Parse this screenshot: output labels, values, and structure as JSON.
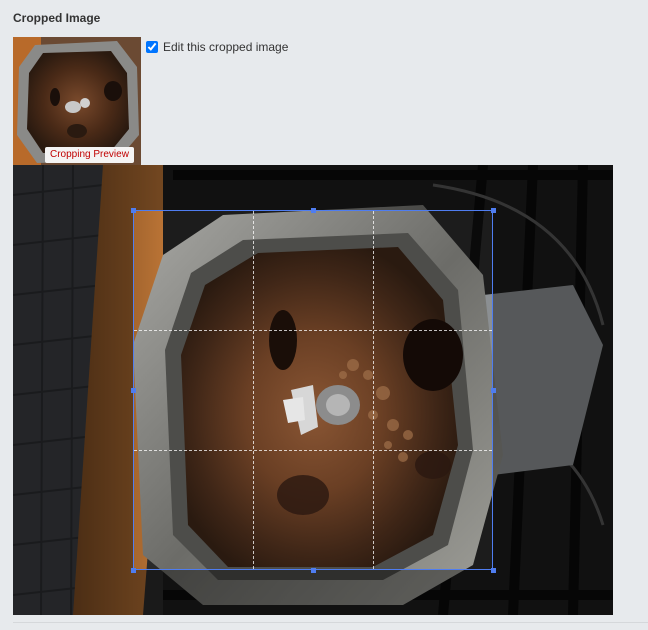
{
  "section": {
    "title": "Cropped Image"
  },
  "preview": {
    "badge": "Cropping Preview"
  },
  "edit_option": {
    "label": "Edit this cropped image",
    "checked": true
  },
  "colors": {
    "crop_border": "#4f7df0",
    "badge_text": "#c00000",
    "background": "#e7eaed"
  }
}
